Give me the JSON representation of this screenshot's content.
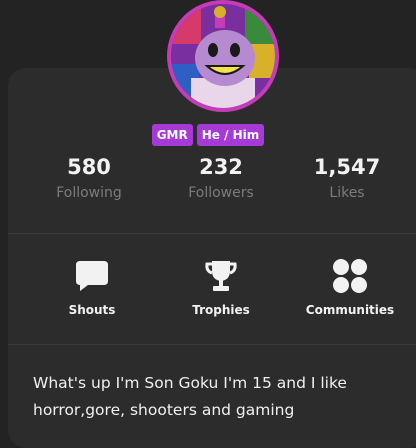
{
  "profile": {
    "badges": [
      "GMR",
      "He / Him"
    ],
    "stats": [
      {
        "value": "580",
        "label": "Following"
      },
      {
        "value": "232",
        "label": "Followers"
      },
      {
        "value": "1,547",
        "label": "Likes"
      }
    ],
    "nav": [
      {
        "label": "Shouts",
        "icon": "speech-bubble-icon"
      },
      {
        "label": "Trophies",
        "icon": "trophy-icon"
      },
      {
        "label": "Communities",
        "icon": "communities-icon"
      }
    ],
    "bio": "What's up I'm Son Goku I'm 15 and I like horror,gore, shooters and gaming"
  },
  "colors": {
    "background": "#232323",
    "card": "#2c2c2c",
    "badge": "#a63ad6",
    "avatar_ring": "#c63bb8"
  }
}
